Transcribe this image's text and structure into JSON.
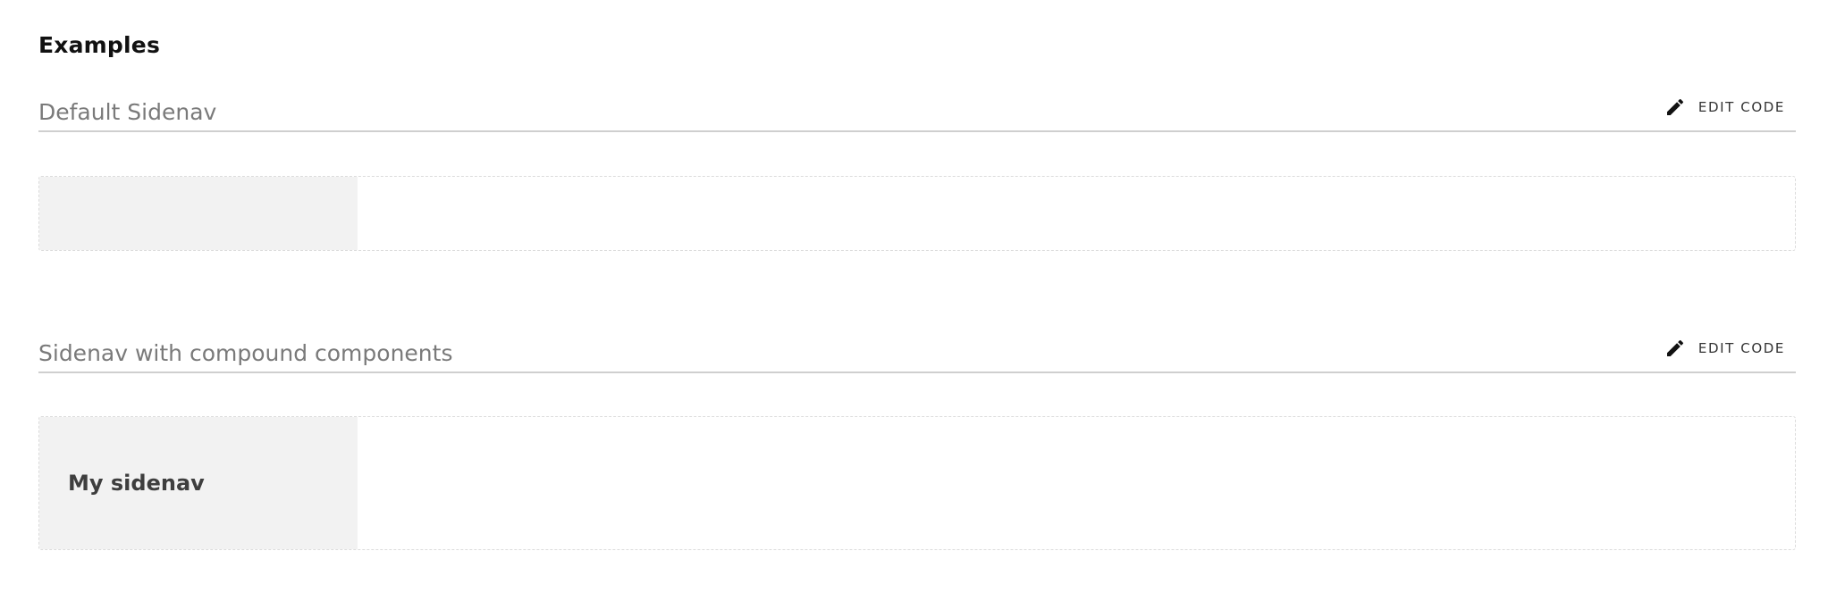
{
  "page": {
    "heading": "Examples"
  },
  "examples": [
    {
      "title": "Default Sidenav",
      "edit_label": "EDIT CODE",
      "sidenav_title": ""
    },
    {
      "title": "Sidenav with compound components",
      "edit_label": "EDIT CODE",
      "sidenav_title": "My sidenav"
    }
  ],
  "colors": {
    "sidenav_background": "#f2f2f2",
    "divider": "#cfcfcf",
    "title_text": "#7a7a7a"
  },
  "icons": {
    "edit": "pencil-icon"
  }
}
